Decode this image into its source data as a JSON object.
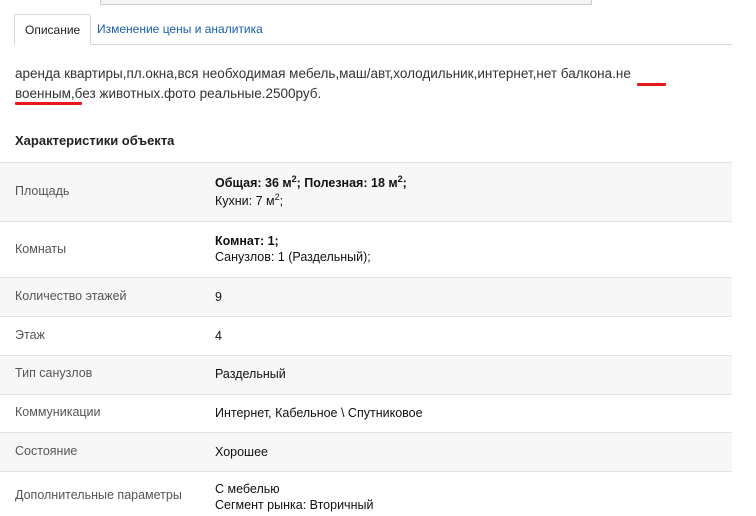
{
  "tabs": [
    {
      "label": "Описание",
      "active": true
    },
    {
      "label": "Изменение цены и аналитика",
      "active": false
    }
  ],
  "description": {
    "line1": "аренда квартиры,пл.окна,вся необходимая мебель,маш/авт,холодильник,интернет,нет балкона.не",
    "line2": "военным,без животных.фото реальные.2500руб."
  },
  "section_title": "Характеристики объекта",
  "specs": {
    "area": {
      "label": "Площадь",
      "total_prefix": "Общая: 36 м",
      "usable_prefix": "; Полезная: 18 м",
      "usable_suffix": ";",
      "kitchen_prefix": "Кухни: 7 м",
      "kitchen_suffix": ";",
      "sup": "2"
    },
    "rooms": {
      "label": "Комнаты",
      "rooms_value": "Комнат: 1;",
      "bathrooms_value": "Санузлов: 1 (Раздельный);"
    },
    "floors_count": {
      "label": "Количество этажей",
      "value": "9"
    },
    "floor": {
      "label": "Этаж",
      "value": "4"
    },
    "bathroom_type": {
      "label": "Тип санузлов",
      "value": "Раздельный"
    },
    "communications": {
      "label": "Коммуникации",
      "value": "Интернет, Кабельное \\ Спутниковое"
    },
    "condition": {
      "label": "Состояние",
      "value": "Хорошее"
    },
    "extra": {
      "label": "Дополнительные параметры",
      "line1": "С мебелью",
      "line2": "Сегмент рынка: Вторичный"
    }
  },
  "colors": {
    "link": "#1a5fad",
    "underline": "#e8191c",
    "row_shade": "#f7f7f7"
  }
}
